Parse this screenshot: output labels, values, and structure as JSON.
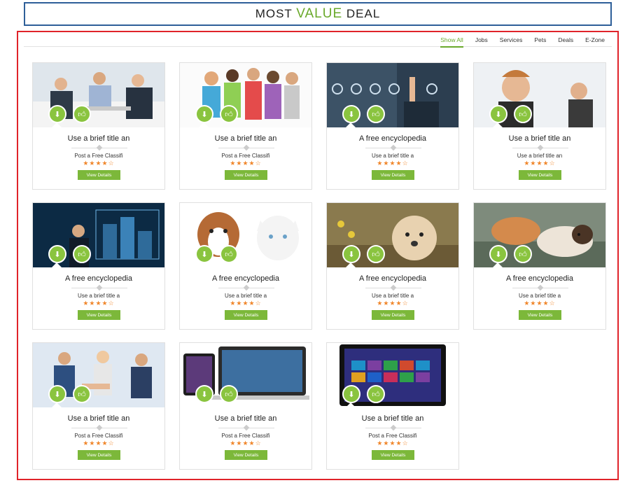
{
  "header": {
    "title_prefix": "MOST ",
    "title_accent": "VALUE",
    "title_suffix": " DEAL"
  },
  "filters": [
    "Show All",
    "Jobs",
    "Services",
    "Pets",
    "Deals",
    "E-Zone"
  ],
  "active_filter": "Show All",
  "colors": {
    "accent_green": "#8ac43f",
    "button_green": "#7cb83a",
    "star_orange": "#f0862a",
    "frame_red": "#e0232a",
    "header_blue": "#2e5f99"
  },
  "icons": {
    "left_action": "download-icon",
    "right_action": "thumbs-up-icon"
  },
  "cards": [
    {
      "title": "Use a brief title an",
      "subtitle": "Post a Free Classifi",
      "stars": "★★★★☆",
      "button": "View Details",
      "image": "business-meeting-photo"
    },
    {
      "title": "Use a brief title an",
      "subtitle": "Post a Free Classifi",
      "stars": "★★★★☆",
      "button": "View Details",
      "image": "students-group-photo"
    },
    {
      "title": "A free encyclopedia",
      "subtitle": "Use a brief title a",
      "stars": "★★★★☆",
      "button": "View Details",
      "image": "touchscreen-icons-photo"
    },
    {
      "title": "Use a brief title an",
      "subtitle": "Use a brief title an",
      "stars": "★★★★☆",
      "button": "View Details",
      "image": "call-center-photo"
    },
    {
      "title": "A free encyclopedia",
      "subtitle": "Use a brief title a",
      "stars": "★★★★☆",
      "button": "View Details",
      "image": "digital-city-photo"
    },
    {
      "title": "A free encyclopedia",
      "subtitle": "Use a brief title a",
      "stars": "★★★★☆",
      "button": "View Details",
      "image": "dog-and-cat-photo"
    },
    {
      "title": "A free encyclopedia",
      "subtitle": "Use a brief title a",
      "stars": "★★★★☆",
      "button": "View Details",
      "image": "puppy-photo"
    },
    {
      "title": "A free encyclopedia",
      "subtitle": "Use a brief title a",
      "stars": "★★★★☆",
      "button": "View Details",
      "image": "cat-and-dog-resting-photo"
    },
    {
      "title": "Use a brief title an",
      "subtitle": "Post a Free Classifi",
      "stars": "★★★★☆",
      "button": "View Details",
      "image": "handshake-photo"
    },
    {
      "title": "Use a brief title an",
      "subtitle": "Post a Free Classifi",
      "stars": "★★★★☆",
      "button": "View Details",
      "image": "tablet-and-laptop-photo"
    },
    {
      "title": "Use a brief title an",
      "subtitle": "Post a Free Classifi",
      "stars": "★★★★☆",
      "button": "View Details",
      "image": "windows-tablet-photo"
    }
  ]
}
